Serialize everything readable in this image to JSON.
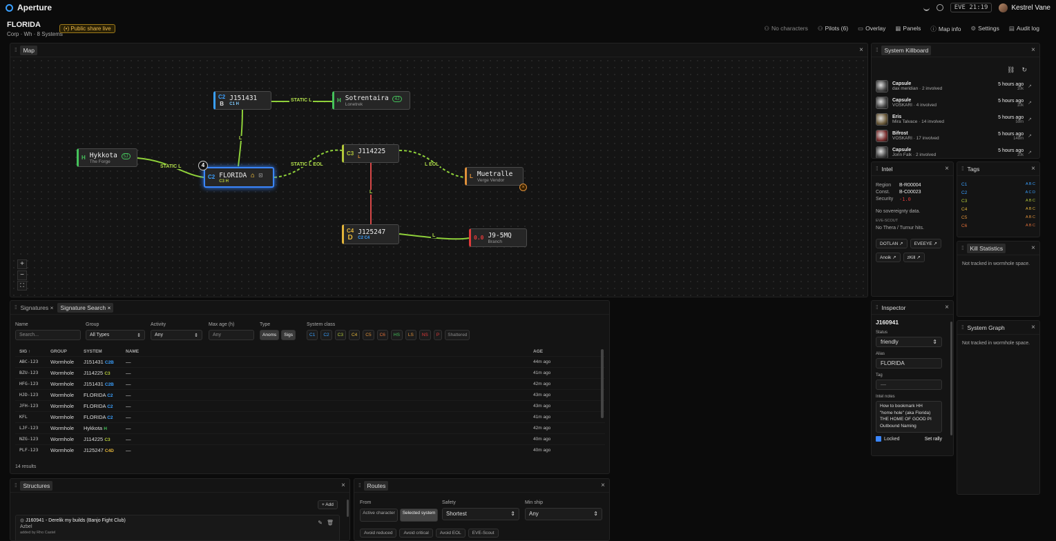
{
  "app": {
    "name": "Aperture",
    "clock": "EVE 21:19",
    "user": "Kestrel Vane"
  },
  "header": {
    "title": "FLORIDA",
    "subtitle": "Corp · Wh · 8 Systems",
    "share": "Public share live"
  },
  "nav": [
    {
      "label": "No characters",
      "icon": "person-icon"
    },
    {
      "label": "Pilots (6)",
      "icon": "pilots-icon"
    },
    {
      "label": "Overlay",
      "icon": "overlay-icon"
    },
    {
      "label": "Panels",
      "icon": "panels-icon"
    },
    {
      "label": "Map info",
      "icon": "info-icon"
    },
    {
      "label": "Settings",
      "icon": "gear-icon"
    },
    {
      "label": "Audit log",
      "icon": "log-icon"
    }
  ],
  "map": {
    "title": "Map",
    "nodes": [
      {
        "id": "j151431",
        "cls": "C2",
        "cls2": "B",
        "name": "J151431",
        "statics": "C1 H",
        "sub": "",
        "color": "#3aa0ff"
      },
      {
        "id": "sotrentaira",
        "cls": "H",
        "cls2": "",
        "name": "Sotrentaira",
        "statics": "",
        "sub": "Lonetrek",
        "badge": "4J",
        "color": "#45c35b"
      },
      {
        "id": "hykkota",
        "cls": "H",
        "cls2": "",
        "name": "Hykkota",
        "statics": "",
        "sub": "The Forge",
        "badge": "5J",
        "color": "#45c35b"
      },
      {
        "id": "florida",
        "cls": "C2",
        "cls2": "",
        "name": "FLORIDA",
        "statics": "C3 H",
        "sub": "",
        "color": "#3aa0ff",
        "count": "4"
      },
      {
        "id": "j114225",
        "cls": "C3",
        "cls2": "",
        "name": "J114225",
        "statics": "L",
        "sub": "",
        "color": "#b3c83a"
      },
      {
        "id": "muetralle",
        "cls": "L",
        "cls2": "",
        "name": "Muetralle",
        "statics": "",
        "sub": "Verge Vendor",
        "color": "#e0913a"
      },
      {
        "id": "j125247",
        "cls": "C4",
        "cls2": "D",
        "name": "J125247",
        "statics": "C2 C4",
        "sub": "",
        "color": "#e3b53a"
      },
      {
        "id": "j95mq",
        "cls": "0.0",
        "cls2": "",
        "name": "J9-5MQ",
        "statics": "",
        "sub": "Branch",
        "color": "#e03a3a"
      }
    ],
    "edges": [
      {
        "label": "STATIC L"
      },
      {
        "label": "L"
      },
      {
        "label": "STATIC L"
      },
      {
        "label": "STATIC L EOL"
      },
      {
        "label": "L EOL"
      },
      {
        "label": "L"
      },
      {
        "label": "L"
      }
    ],
    "zoom": [
      "+",
      "−",
      "⛶"
    ]
  },
  "signatures": {
    "tabs": [
      "Signatures",
      "Signature Search"
    ],
    "filters": {
      "name_label": "Name",
      "name_placeholder": "Search...",
      "group_label": "Group",
      "group_value": "All Types",
      "activity_label": "Activity",
      "activity_value": "Any",
      "maxage_label": "Max age (h)",
      "maxage_placeholder": "Any",
      "type_label": "Type",
      "types": [
        "Anoms",
        "Sigs"
      ],
      "class_label": "System class",
      "classes": [
        {
          "t": "C1",
          "c": "#3aa0ff"
        },
        {
          "t": "C2",
          "c": "#3aa0ff"
        },
        {
          "t": "C3",
          "c": "#b3c83a"
        },
        {
          "t": "C4",
          "c": "#e3b53a"
        },
        {
          "t": "C5",
          "c": "#e0913a"
        },
        {
          "t": "C6",
          "c": "#e0703a"
        },
        {
          "t": "HS",
          "c": "#45c35b"
        },
        {
          "t": "LS",
          "c": "#e0913a"
        },
        {
          "t": "NS",
          "c": "#e03a3a"
        },
        {
          "t": "P",
          "c": "#e03a3a"
        },
        {
          "t": "Shattered",
          "c": "#888"
        }
      ]
    },
    "columns": [
      "SIG ↑",
      "GROUP",
      "SYSTEM",
      "NAME",
      "AGE"
    ],
    "rows": [
      {
        "sig": "ABC-123",
        "group": "Wormhole",
        "system": "J151431",
        "tag": "C2B",
        "tagc": "#3aa0ff",
        "name": "—",
        "age": "44m ago"
      },
      {
        "sig": "BZU-123",
        "group": "Wormhole",
        "system": "J114225",
        "tag": "C3",
        "tagc": "#b3c83a",
        "name": "—",
        "age": "41m ago"
      },
      {
        "sig": "HFG-123",
        "group": "Wormhole",
        "system": "J151431",
        "tag": "C2B",
        "tagc": "#3aa0ff",
        "name": "—",
        "age": "42m ago"
      },
      {
        "sig": "HJD-123",
        "group": "Wormhole",
        "system": "FLORIDA",
        "tag": "C2",
        "tagc": "#3aa0ff",
        "name": "—",
        "age": "43m ago"
      },
      {
        "sig": "JFH-123",
        "group": "Wormhole",
        "system": "FLORIDA",
        "tag": "C2",
        "tagc": "#3aa0ff",
        "name": "—",
        "age": "43m ago"
      },
      {
        "sig": "KFL",
        "group": "Wormhole",
        "system": "FLORIDA",
        "tag": "C2",
        "tagc": "#3aa0ff",
        "name": "—",
        "age": "41m ago"
      },
      {
        "sig": "LJF-123",
        "group": "Wormhole",
        "system": "Hykkota",
        "tag": "H",
        "tagc": "#45c35b",
        "name": "—",
        "age": "42m ago"
      },
      {
        "sig": "NZG-123",
        "group": "Wormhole",
        "system": "J114225",
        "tag": "C3",
        "tagc": "#b3c83a",
        "name": "—",
        "age": "40m ago"
      },
      {
        "sig": "PLF-123",
        "group": "Wormhole",
        "system": "J125247",
        "tag": "C4D",
        "tagc": "#e3b53a",
        "name": "—",
        "age": "40m ago"
      }
    ],
    "count": "14 results"
  },
  "killboard": {
    "title": "System Killboard",
    "rows": [
      {
        "ship": "Capsule",
        "who": "dax meridian · 2 involved",
        "when": "5 hours ago",
        "isk": "10k"
      },
      {
        "ship": "Capsule",
        "who": "VOSKARI · 4 involved",
        "when": "5 hours ago",
        "isk": "10k"
      },
      {
        "ship": "Eris",
        "who": "Mira Talvace · 14 involved",
        "when": "5 hours ago",
        "isk": "59m"
      },
      {
        "ship": "Bifrost",
        "who": "VOSKARI · 17 involved",
        "when": "5 hours ago",
        "isk": "148m"
      },
      {
        "ship": "Capsule",
        "who": "Jorin Falk · 2 involved",
        "when": "5 hours ago",
        "isk": "10k"
      }
    ]
  },
  "intel": {
    "title": "Intel",
    "region_label": "Region",
    "region": "B-R00004",
    "const_label": "Const.",
    "const": "B-C00023",
    "sec_label": "Security",
    "sec": "-1.0",
    "sov": "No sovereignty data.",
    "scout_label": "EVE-SCOUT",
    "scout": "No Thera / Turnur hits.",
    "links": [
      "DOTLAN",
      "EVEEYE",
      "Anoik",
      "zKill"
    ]
  },
  "tags": {
    "title": "Tags",
    "rows": [
      {
        "c": "C1",
        "col": "#3aa0ff",
        "t": "A B C"
      },
      {
        "c": "C2",
        "col": "#3aa0ff",
        "t": "A C D"
      },
      {
        "c": "C3",
        "col": "#b3c83a",
        "t": "A B C"
      },
      {
        "c": "C4",
        "col": "#e3b53a",
        "t": "A B C"
      },
      {
        "c": "C5",
        "col": "#e0913a",
        "t": "A B C"
      },
      {
        "c": "C6",
        "col": "#e0703a",
        "t": "A B C"
      }
    ]
  },
  "killstats": {
    "title": "Kill Statistics",
    "msg": "Not tracked in wormhole space."
  },
  "inspector": {
    "title": "Inspector",
    "system": "J160941",
    "status_label": "Status",
    "status": "friendly",
    "alias_label": "Alias",
    "alias": "FLORIDA",
    "tag_label": "Tag",
    "tag": "—",
    "notes_label": "Intel notes",
    "notes": "How to bookmark HH \"home hole\" (aka Florida) THE HOME OF GOOD PI Outbound Naming",
    "locked": "Locked",
    "rally": "Set rally"
  },
  "sysgraph": {
    "title": "System Graph",
    "msg": "Not tracked in wormhole space."
  },
  "structures": {
    "title": "Structures",
    "add": "+ Add",
    "item_title": "J160941 - Derelik my builds (Banjo Fight Club)",
    "item_type": "Azbel",
    "item_by": "added by Rho Castel"
  },
  "routes": {
    "title": "Routes",
    "from_label": "From",
    "from_opts": [
      "Active character",
      "Selected system"
    ],
    "safety_label": "Safety",
    "safety": "Shortest",
    "minship_label": "Min ship",
    "minship": "Any",
    "avoid": [
      "Avoid reduced",
      "Avoid critical",
      "Avoid EOL",
      "EVE-Scout"
    ]
  }
}
